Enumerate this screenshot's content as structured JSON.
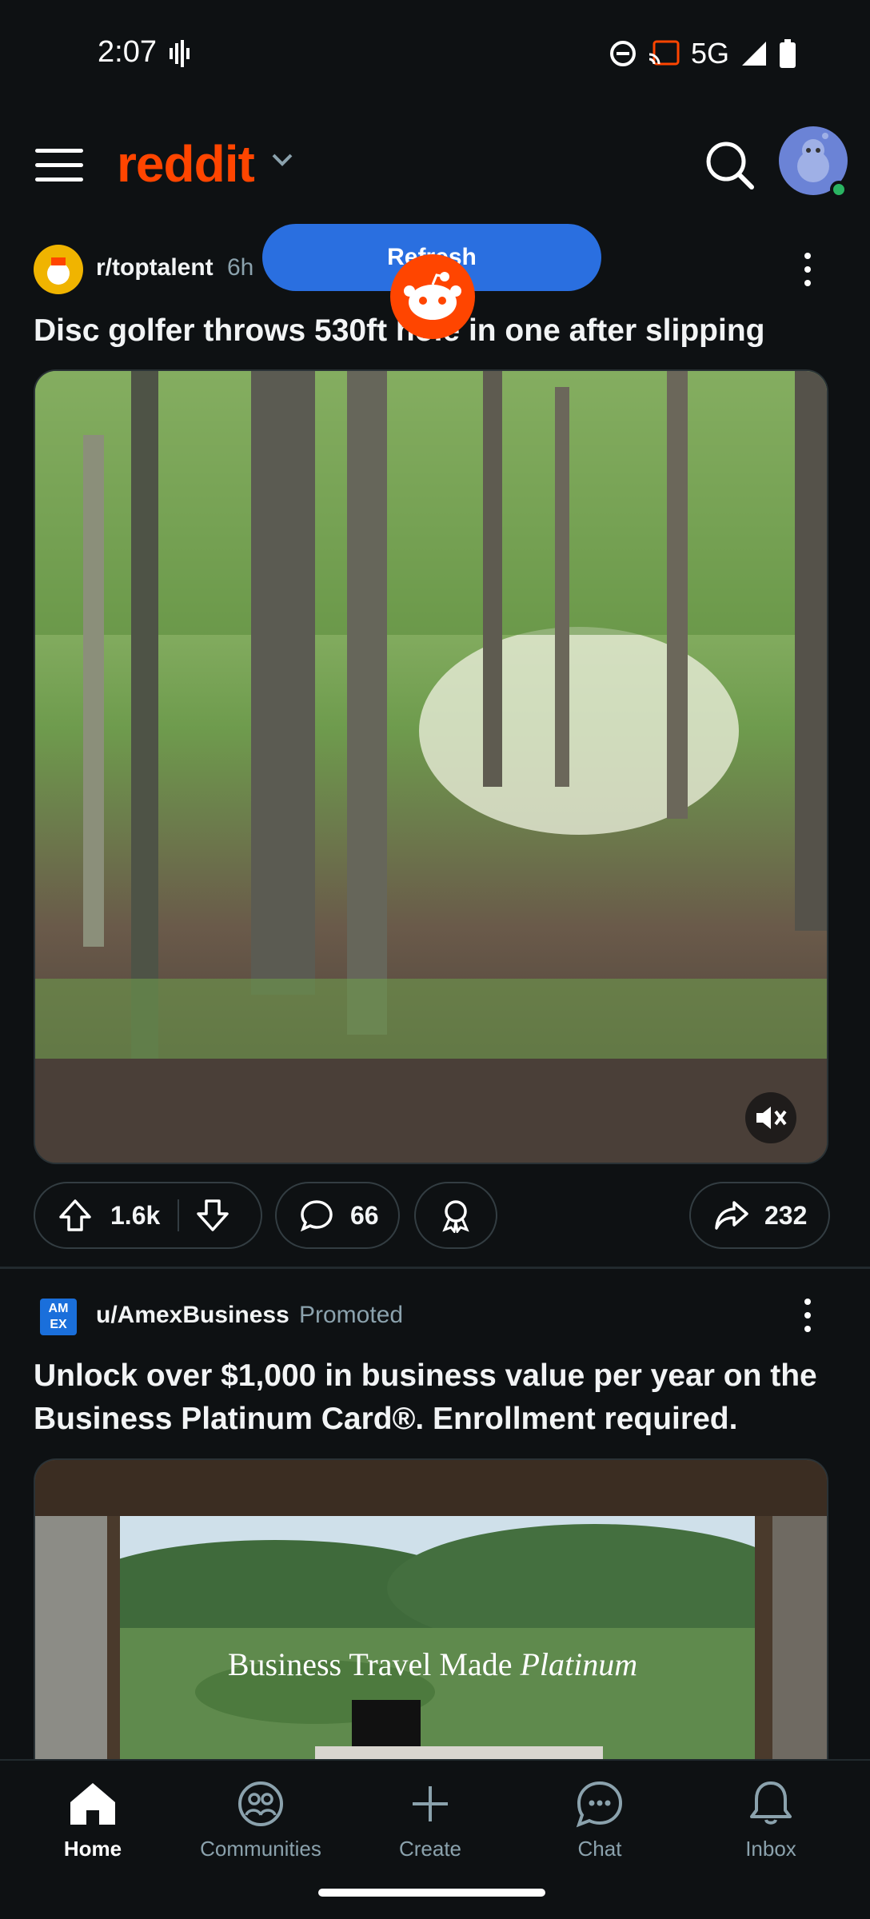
{
  "status_bar": {
    "time": "2:07",
    "network": "5G"
  },
  "header": {
    "logo": "reddit"
  },
  "refresh_label": "Refresh",
  "post1": {
    "subreddit": "r/toptalent",
    "age": "6h",
    "title": "Disc golfer throws 530ft hole in one after slipping",
    "upvotes": "1.6k",
    "comments": "66",
    "shares": "232"
  },
  "post2": {
    "user": "u/AmexBusiness",
    "badge": "Promoted",
    "title": "Unlock over $1,000 in business value per year on the Business Platinum Card®. Enrollment required.",
    "ad_text_plain": "Business Travel Made",
    "ad_text_italic": "Platinum",
    "amex_logo": "AM EX"
  },
  "nav": [
    {
      "label": "Home",
      "icon": "home-icon",
      "active": true
    },
    {
      "label": "Communities",
      "icon": "communities-icon"
    },
    {
      "label": "Create",
      "icon": "plus-icon"
    },
    {
      "label": "Chat",
      "icon": "chat-icon"
    },
    {
      "label": "Inbox",
      "icon": "bell-icon"
    }
  ],
  "colors": {
    "accent": "#ff4500",
    "refresh": "#2a6fe0",
    "background": "#0e1113"
  }
}
